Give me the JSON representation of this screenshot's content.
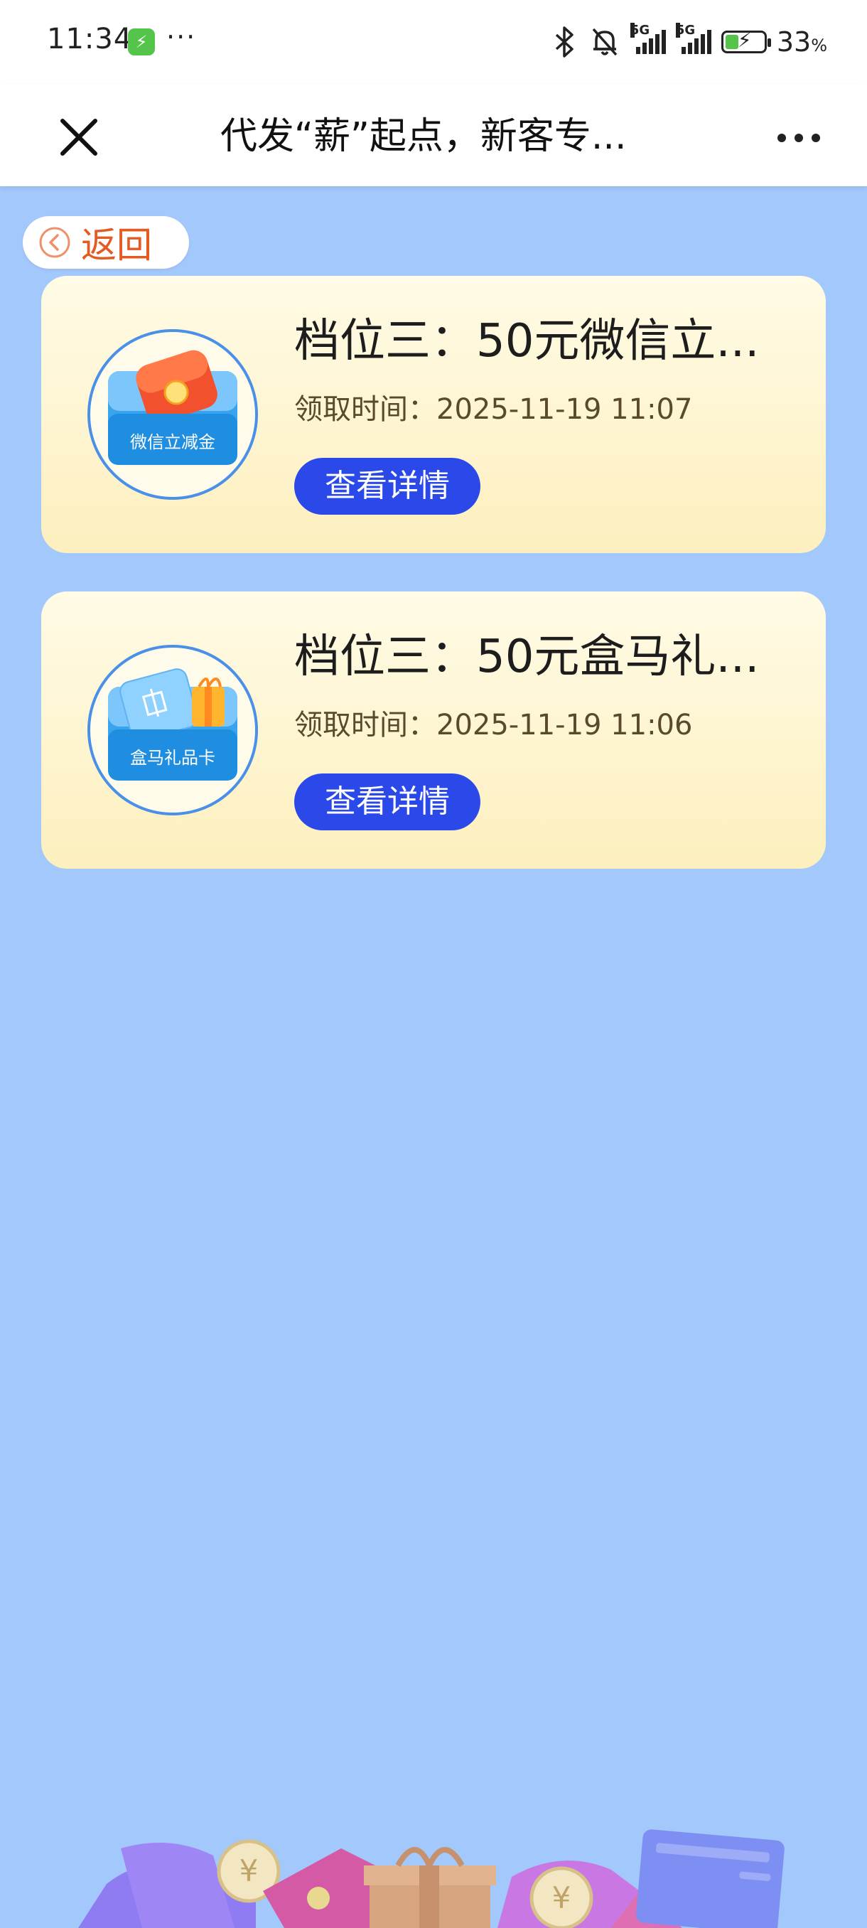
{
  "status_bar": {
    "time": "11:34",
    "network_label": "5G",
    "battery_percent": "33",
    "battery_unit": "%"
  },
  "nav": {
    "title": "代发“薪”起点，新客专..."
  },
  "back": {
    "label": "返回"
  },
  "cards": [
    {
      "title": "档位三：50元微信立...",
      "time_label": "领取时间：",
      "time": "2025-11-19 11:07",
      "button_label": "查看详情",
      "icon_label": "微信立减金"
    },
    {
      "title": "档位三：50元盒马礼...",
      "time_label": "领取时间：",
      "time": "2025-11-19 11:06",
      "button_label": "查看详情",
      "icon_label": "盒马礼品卡"
    }
  ],
  "colors": {
    "page_background": "#a3c8fb",
    "button_blue": "#2b49e8",
    "back_orange": "#e55a22",
    "card_gradient_top": "#fffbe6",
    "card_gradient_bottom": "#fdefbe"
  }
}
